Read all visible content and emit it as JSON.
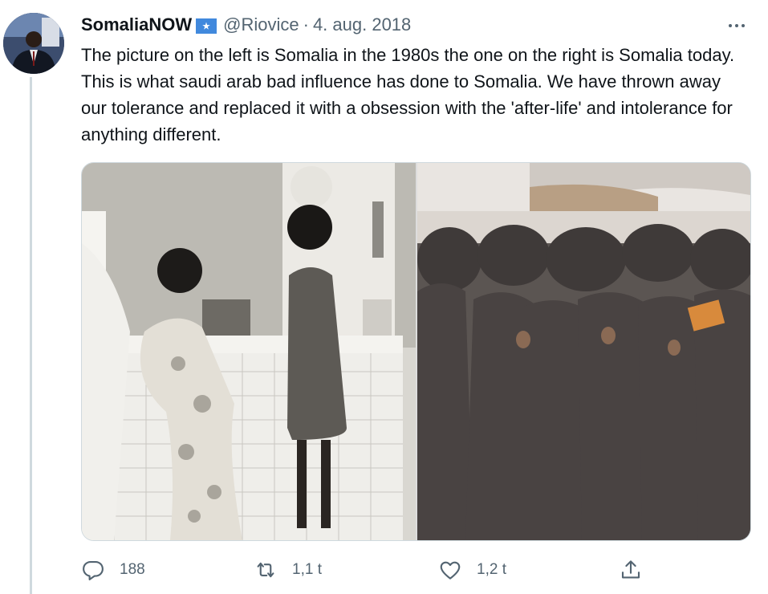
{
  "tweet": {
    "author_name": "SomaliaNOW",
    "handle": "@Riovice",
    "separator": "·",
    "date": "4. aug. 2018",
    "text": "The picture on the left is Somalia in the 1980s the one on the right is Somalia today. This is what saudi arab bad influence has done to Somalia. We have thrown away our tolerance and replaced it with a obsession with the 'after-life' and intolerance for anything different."
  },
  "icons": {
    "flag": "somalia-flag-icon",
    "more": "more-options-icon",
    "reply": "reply-icon",
    "retweet": "retweet-icon",
    "like": "heart-icon",
    "share": "share-icon"
  },
  "actions": {
    "reply_count": "188",
    "retweet_count": "1,1 t",
    "like_count": "1,2 t"
  },
  "colors": {
    "text": "#0f1419",
    "secondary": "#536471",
    "border": "#cfd9de",
    "flag_blue": "#4189dd"
  }
}
